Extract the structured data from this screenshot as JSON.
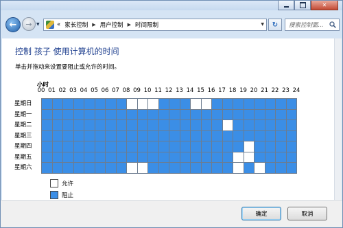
{
  "nav": {
    "breadcrumbs": [
      "家长控制",
      "用户控制",
      "时间限制"
    ],
    "breadcrumb_prefix": "«",
    "search_placeholder": "搜索控制面..."
  },
  "content": {
    "heading": "控制 孩子 使用计算机的时间",
    "instruction": "单击并拖动来设置要阻止或允许的时间。",
    "hour_axis_label": "小时",
    "hours": [
      "00",
      "01",
      "02",
      "03",
      "04",
      "05",
      "06",
      "07",
      "08",
      "09",
      "10",
      "11",
      "12",
      "13",
      "14",
      "15",
      "16",
      "17",
      "18",
      "19",
      "20",
      "21",
      "22",
      "23",
      "24"
    ],
    "days": [
      "星期日",
      "星期一",
      "星期二",
      "星期三",
      "星期四",
      "星期五",
      "星期六"
    ],
    "allowed": {
      "星期日": [
        8,
        9,
        10,
        14,
        15
      ],
      "星期一": [],
      "星期二": [
        17
      ],
      "星期三": [],
      "星期四": [
        19
      ],
      "星期五": [
        18,
        19
      ],
      "星期六": [
        8,
        9,
        18,
        20
      ]
    },
    "colors": {
      "blocked": "#3b8ee6",
      "allowed": "#ffffff"
    }
  },
  "legend": {
    "allow_label": "允许",
    "block_label": "阻止"
  },
  "buttons": {
    "ok": "确定",
    "cancel": "取消"
  }
}
